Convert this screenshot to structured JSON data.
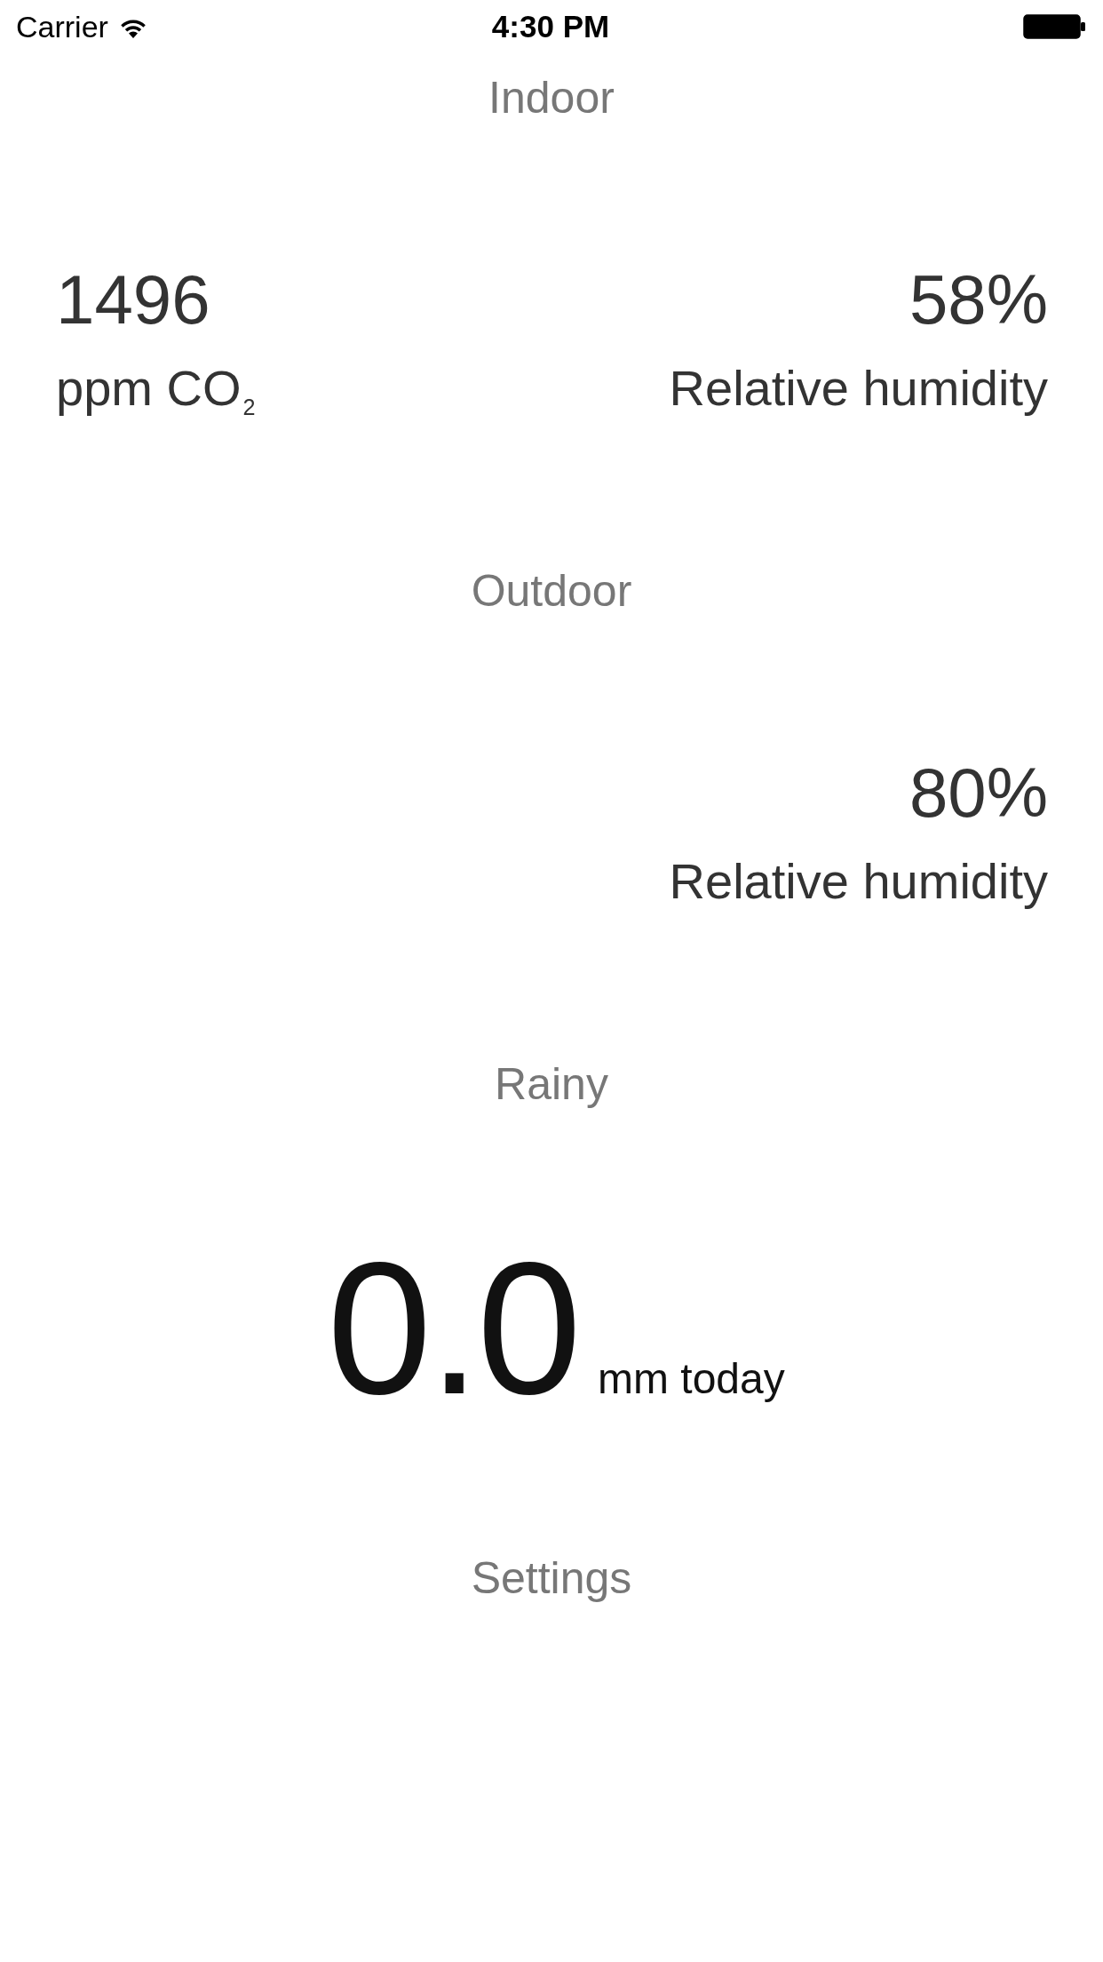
{
  "status_bar": {
    "carrier": "Carrier",
    "time": "4:30 PM"
  },
  "sections": [
    {
      "kind": "readings",
      "title": "Indoor",
      "readings": {
        "left": {
          "value": "1496",
          "label": "ppm CO$_{2}$"
        },
        "right": {
          "value": "58%",
          "label": "Relative humidity"
        }
      }
    },
    {
      "kind": "readings",
      "title": "Outdoor",
      "readings": {
        "right": {
          "value": "80%",
          "label": "Relative humidity"
        }
      }
    },
    {
      "kind": "rain",
      "title": "Rainy",
      "amount": "0.0",
      "unit": "mm today"
    },
    {
      "kind": "link",
      "title": "Settings"
    }
  ]
}
